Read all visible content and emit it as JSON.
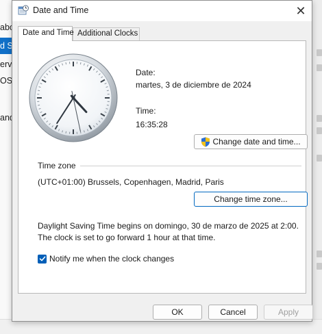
{
  "background": {
    "sidebar_items": [
      {
        "label": "abo",
        "selected": false
      },
      {
        "label": "d Se",
        "selected": true
      },
      {
        "label": "erv",
        "selected": false
      },
      {
        "label": "OS",
        "selected": false
      },
      {
        "label": "and",
        "selected": false
      }
    ]
  },
  "dialog": {
    "title": "Date and Time",
    "close_glyph": "✕"
  },
  "tabs": [
    {
      "label": "Date and Time",
      "active": true
    },
    {
      "label": "Additional Clocks",
      "active": false
    }
  ],
  "clock": {
    "hour": 16,
    "minute": 35,
    "second": 28
  },
  "date": {
    "label": "Date:",
    "value": "martes, 3 de diciembre de 2024"
  },
  "time": {
    "label": "Time:",
    "value": "16:35:28"
  },
  "buttons": {
    "change_datetime": "Change date and time...",
    "change_timezone": "Change time zone...",
    "ok": "OK",
    "cancel": "Cancel",
    "apply": "Apply"
  },
  "timezone": {
    "heading": "Time zone",
    "value": "(UTC+01:00) Brussels, Copenhagen, Madrid, Paris"
  },
  "dst": {
    "text": "Daylight Saving Time begins on domingo, 30 de marzo de 2025 at 2:00. The clock is set to go forward 1 hour at that time."
  },
  "notify": {
    "label": "Notify me when the clock changes",
    "checked": true
  },
  "colors": {
    "accent": "#0067c0",
    "checkbox": "#005fb8",
    "selected_sidebar": "#1170c8"
  }
}
